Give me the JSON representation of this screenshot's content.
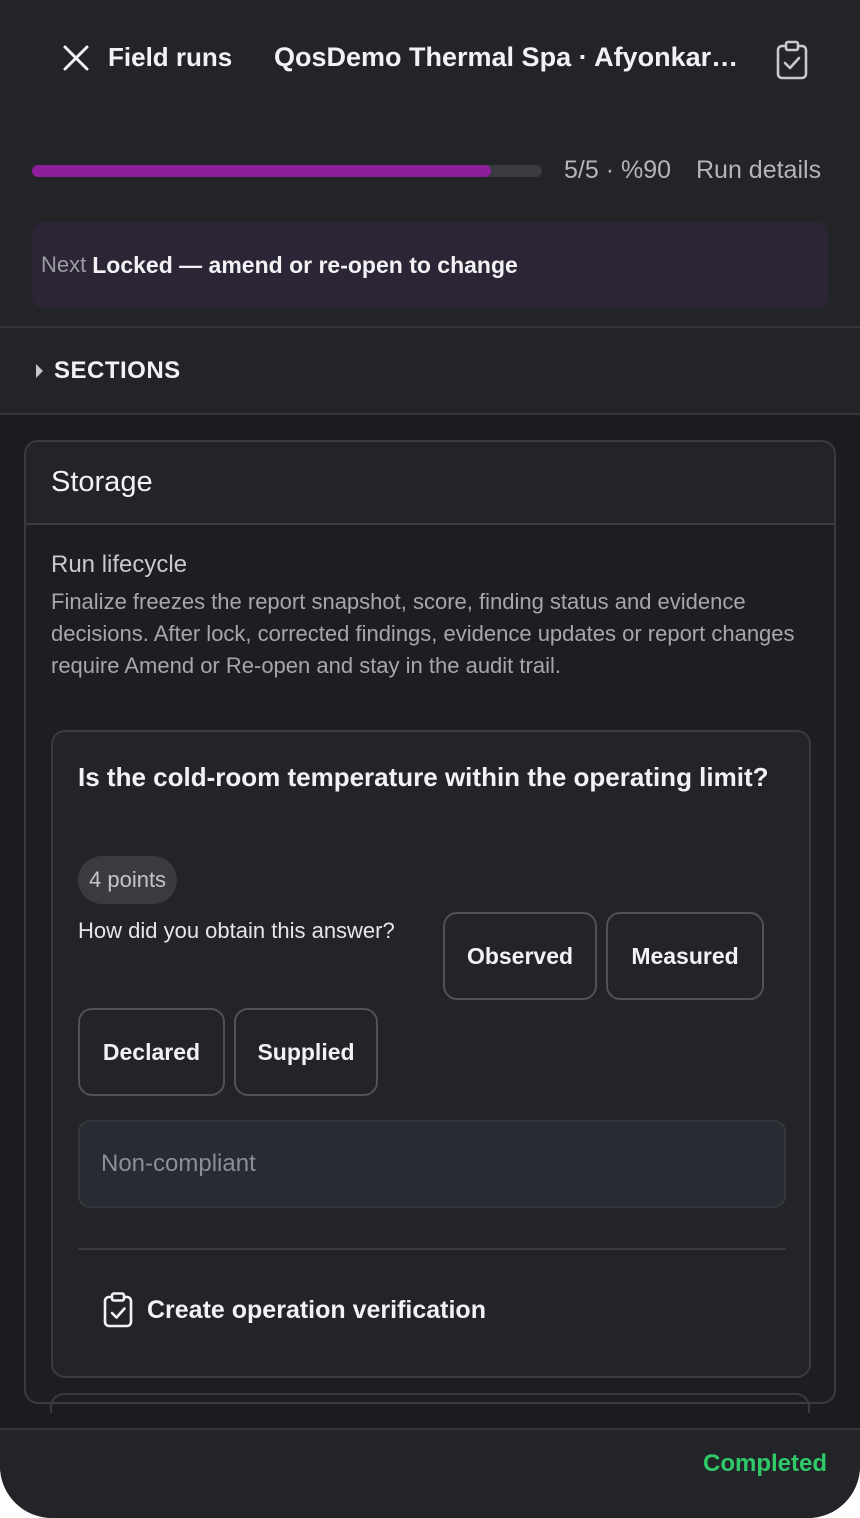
{
  "header": {
    "back_label": "Field runs",
    "title": "QosDemo Thermal Spa · Afyonkarahisar",
    "progress": {
      "value": 0.9,
      "text": "5/5 · %90",
      "color": "#8e1e9a"
    },
    "run_details_label": "Run details",
    "next_banner": {
      "label": "Next",
      "text": "Locked — amend or re-open to change"
    }
  },
  "sections": {
    "label": "SECTIONS"
  },
  "storage": {
    "title": "Storage",
    "lifecycle_title": "Run lifecycle",
    "lifecycle_text": "Finalize freezes the report snapshot, score, finding status and evidence decisions. After lock, corrected findings, evidence updates or report changes require Amend or Re-open and stay in the audit trail.",
    "question": {
      "text": "Is the cold-room temperature within the operating limit?",
      "points": "4 points",
      "how_label": "How did you obtain this answer?",
      "methods": [
        "Observed",
        "Measured",
        "Declared",
        "Supplied"
      ],
      "status_placeholder": "Non-compliant",
      "create_label": "Create operation verification"
    }
  },
  "footer": {
    "status": "Completed",
    "status_color": "#30c96a"
  },
  "icons": [
    "close-icon",
    "clipboard-check-icon",
    "caret-right-icon"
  ]
}
